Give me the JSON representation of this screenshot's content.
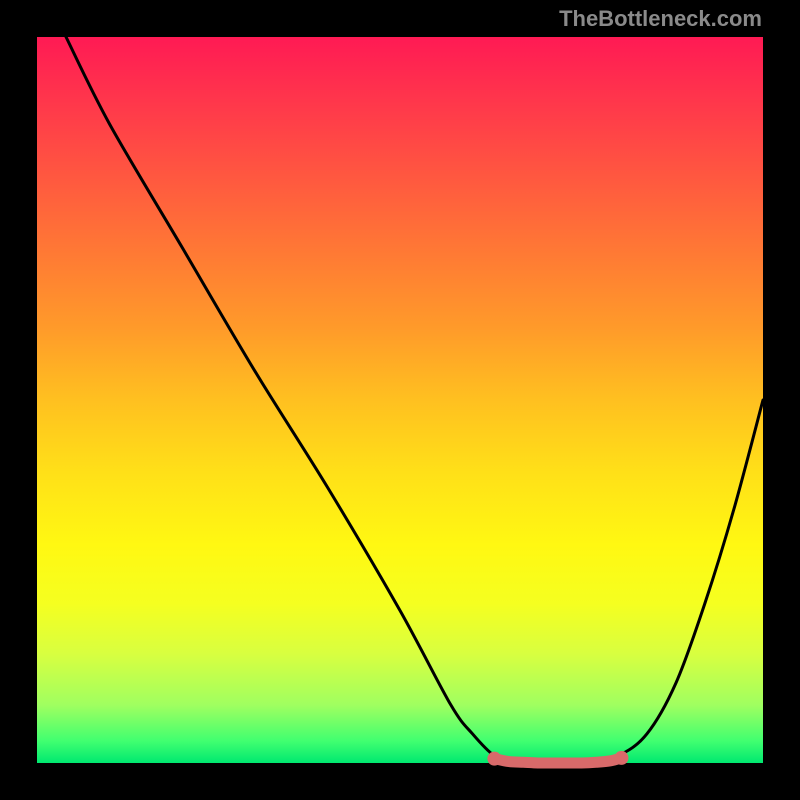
{
  "watermark": "TheBottleneck.com",
  "chart_data": {
    "type": "line",
    "title": "",
    "xlabel": "",
    "ylabel": "",
    "xlim": [
      0,
      100
    ],
    "ylim": [
      0,
      100
    ],
    "grid": false,
    "series": [
      {
        "name": "bottleneck-curve",
        "color": "#000000",
        "x": [
          4,
          10,
          20,
          30,
          40,
          50,
          57,
          60,
          63,
          66,
          70,
          75,
          80,
          84,
          88,
          92,
          96,
          100
        ],
        "y": [
          100,
          88,
          71,
          54,
          38,
          21,
          8,
          4,
          1,
          0,
          0,
          0,
          1,
          4,
          11,
          22,
          35,
          50
        ]
      },
      {
        "name": "optimal-flat-region",
        "color": "#d86a6a",
        "x": [
          63,
          65,
          67,
          69,
          71,
          73,
          75,
          77,
          79,
          80.5
        ],
        "y": [
          0.6,
          0.2,
          0.1,
          0.0,
          0.0,
          0.0,
          0.0,
          0.1,
          0.3,
          0.7
        ]
      }
    ],
    "markers": [
      {
        "name": "optimal-start-dot",
        "x": 63,
        "y": 0.6,
        "color": "#d86a6a",
        "r": 7
      },
      {
        "name": "optimal-end-dot",
        "x": 80.5,
        "y": 0.7,
        "color": "#d86a6a",
        "r": 7
      }
    ]
  }
}
